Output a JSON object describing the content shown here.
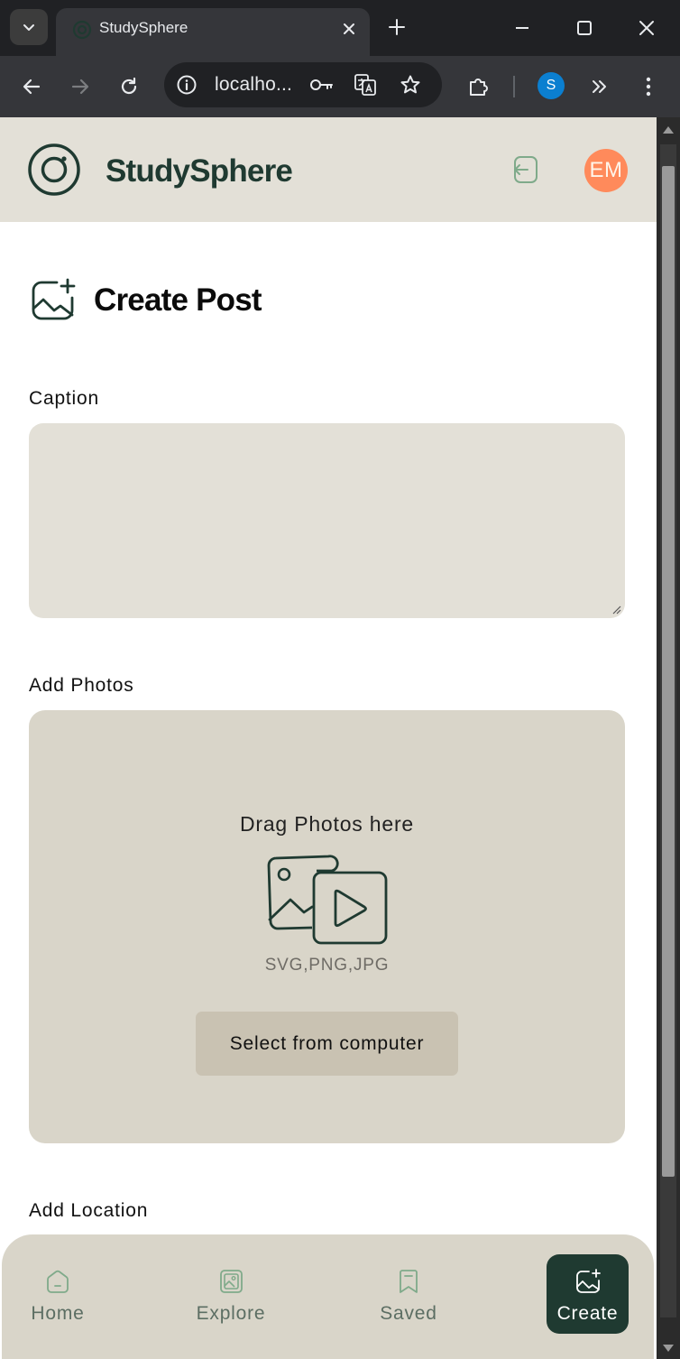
{
  "browser": {
    "tab_title": "StudySphere",
    "url": "localho...",
    "profile_initial": "S"
  },
  "app": {
    "brand": "StudySphere",
    "avatar_initials": "EM",
    "colors": {
      "primary": "#1f3a31",
      "header_bg": "#e3e0d7",
      "surface": "#d9d5c9",
      "avatar": "#ff8a5b"
    }
  },
  "page": {
    "title": "Create Post",
    "caption_label": "Caption",
    "caption_value": "",
    "photos_label": "Add Photos",
    "drag_text": "Drag Photos here",
    "formats": "SVG,PNG,JPG",
    "select_button": "Select from computer",
    "location_label": "Add Location"
  },
  "nav": {
    "items": [
      {
        "label": "Home",
        "icon": "home-icon",
        "active": false
      },
      {
        "label": "Explore",
        "icon": "gallery-icon",
        "active": false
      },
      {
        "label": "Saved",
        "icon": "bookmark-icon",
        "active": false
      },
      {
        "label": "Create",
        "icon": "image-plus-icon",
        "active": true
      }
    ]
  }
}
